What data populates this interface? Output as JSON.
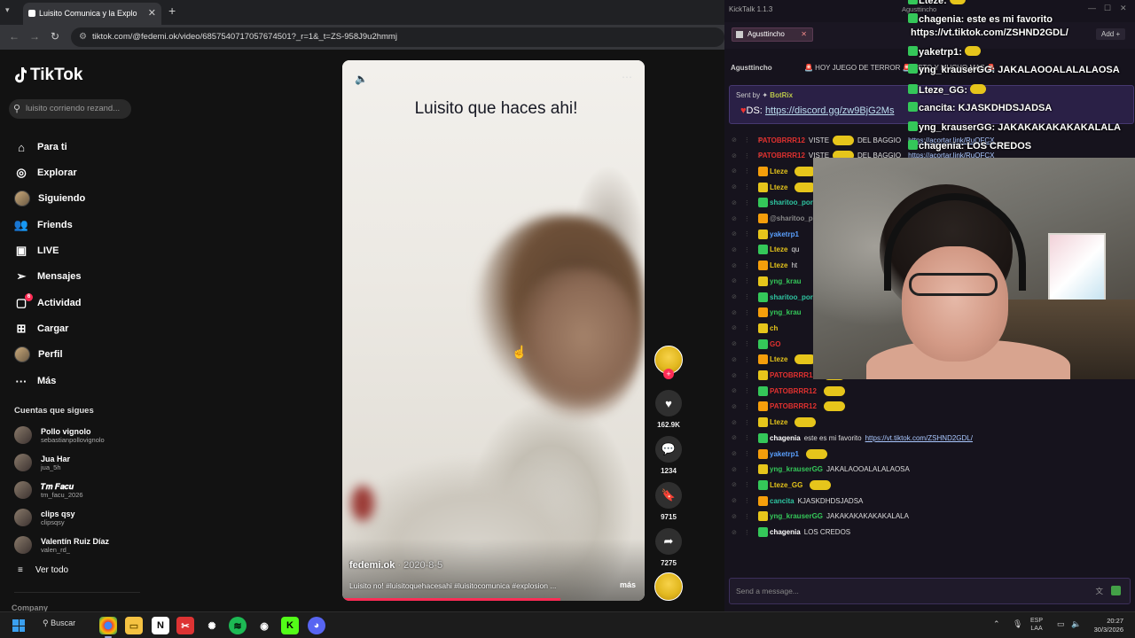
{
  "browser": {
    "tab_title": "Luisito Comunica y la Explo",
    "url": "tiktok.com/@fedemi.ok/video/6857540717057674501?_r=1&_t=ZS-958J9u2hmmj",
    "new_tab": "+",
    "tab_close": "✕"
  },
  "tiktok": {
    "logo": "TikTok",
    "search_placeholder": "luisito corriendo rezand...",
    "nav": [
      {
        "label": "Para ti",
        "icon": "home-icon"
      },
      {
        "label": "Explorar",
        "icon": "compass-icon"
      },
      {
        "label": "Siguiendo",
        "icon": "avatar"
      },
      {
        "label": "Friends",
        "icon": "friends-icon"
      },
      {
        "label": "LIVE",
        "icon": "live-icon"
      },
      {
        "label": "Mensajes",
        "icon": "send-icon"
      },
      {
        "label": "Actividad",
        "icon": "activity-icon",
        "badge": "6"
      },
      {
        "label": "Cargar",
        "icon": "upload-icon"
      },
      {
        "label": "Perfil",
        "icon": "avatar"
      },
      {
        "label": "Más",
        "icon": "more-icon"
      }
    ],
    "following_title": "Cuentas que sigues",
    "following": [
      {
        "name": "Pollo vignolo",
        "handle": "sebastianpollovignolo"
      },
      {
        "name": "Jua Har",
        "handle": "jua_5h"
      },
      {
        "name": "𝑻𝒎 𝑭𝒂𝒄𝒖",
        "handle": "tm_facu_2026"
      },
      {
        "name": "clips qsy",
        "handle": "clipsqsy"
      },
      {
        "name": "Valentín Ruiz Díaz",
        "handle": "valen_rd_"
      }
    ],
    "see_all": "Ver todo",
    "company": "Company",
    "video": {
      "caption": "Luisito que haces ahi!",
      "author": "fedemi.ok",
      "date": " · 2020-8-5",
      "description": "Luisito no! #luisitoquehacesahi #luisitocomunica #explosion ...",
      "more": "más",
      "progress": 0.72
    },
    "actions": {
      "likes": "162.9K",
      "comments": "1234",
      "saves": "9715",
      "shares": "7275"
    }
  },
  "kicktalk": {
    "title": "KickTalk 1.1.3",
    "window_user": "Agusttincho",
    "tab": "Agusttincho",
    "add": "Add",
    "channel": "Agusttincho",
    "stream_title": "🚨 HOY JUEGO DE TERROR 🚨 ESTO Y MUCHO MAS 🚨",
    "pinned_by_label": "Sent by",
    "pinned_by": "BotRix",
    "pinned_ds": "DS:",
    "pinned_link": "https://discord.gg/zw9BjG2Ms",
    "messages": [
      {
        "user": "PATOBRRR12",
        "text": "VISTE",
        "emote": true,
        "text2": "DEL BAGGIO",
        "link": "https://acortar.link/RuQFCX",
        "color": "#e0312f"
      },
      {
        "user": "PATOBRRR12",
        "text": "VISTE",
        "emote": true,
        "text2": "DEL BAGGIO",
        "link": "https://acortar.link/RuQFCX",
        "color": "#e0312f"
      },
      {
        "user": "Lteze",
        "text": "",
        "emote": true,
        "color": "#e6c51b"
      },
      {
        "user": "Lteze",
        "text": "",
        "emote": true,
        "color": "#e6c51b"
      },
      {
        "user": "sharitoo_por",
        "text": "",
        "color": "#2ec4a0"
      },
      {
        "user": "@sharitoo_por: lo",
        "text": "",
        "color": "#888"
      },
      {
        "user": "yaketrp1",
        "text": "",
        "color": "#5aa0ff"
      },
      {
        "user": "Lteze",
        "text": "qu",
        "color": "#e6c51b"
      },
      {
        "user": "Lteze",
        "text": "ht",
        "color": "#e6c51b"
      },
      {
        "user": "yng_krau",
        "text": "",
        "color": "#34c759"
      },
      {
        "user": "sharitoo_por",
        "text": "",
        "color": "#2ec4a0"
      },
      {
        "user": "yng_krau",
        "text": "",
        "color": "#34c759"
      },
      {
        "user": "ch",
        "text": "",
        "color": "#e6c51b"
      },
      {
        "user": "GO",
        "text": "",
        "color": "#e0312f"
      },
      {
        "user": "Lteze",
        "text": "",
        "emote": true,
        "color": "#e6c51b"
      },
      {
        "user": "PATOBRRR12",
        "text": "",
        "emote": true,
        "color": "#e0312f"
      },
      {
        "user": "PATOBRRR12",
        "text": "",
        "emote": true,
        "color": "#e0312f"
      },
      {
        "user": "PATOBRRR12",
        "text": "",
        "emote": true,
        "color": "#e0312f"
      },
      {
        "user": "Lteze",
        "text": "",
        "emote": true,
        "color": "#e6c51b"
      },
      {
        "user": "chagenia",
        "text": "este es mi favorito",
        "link": "https://vt.tiktok.com/ZSHND2GDL/",
        "color": "#ffffff"
      },
      {
        "user": "yaketrp1",
        "text": "",
        "emote": true,
        "color": "#5aa0ff"
      },
      {
        "user": "yng_krauserGG",
        "text": "JAKALAOOALALALAOSA",
        "color": "#34c759"
      },
      {
        "user": "Lteze_GG",
        "text": "",
        "emote": true,
        "color": "#e6c51b"
      },
      {
        "user": "cancita",
        "text": "KJASKDHDSJADSA",
        "color": "#2ec4a0"
      },
      {
        "user": "yng_krauserGG",
        "text": "JAKAKAKAKAKAKALALA",
        "color": "#34c759"
      },
      {
        "user": "chagenia",
        "text": "LOS CREDOS",
        "color": "#ffffff"
      }
    ],
    "input_placeholder": "Send a message...",
    "overlay": [
      {
        "user": "Lteze:",
        "text": "",
        "emote": true
      },
      {
        "user": "chagenia:",
        "text": "este es mi favorito"
      },
      {
        "user": "",
        "text": "https://vt.tiktok.com/ZSHND2GDL/"
      },
      {
        "user": "yaketrp1:",
        "text": "",
        "emote": true
      },
      {
        "user": "yng_krauserGG:",
        "text": "JAKALAOOALALALAOSA"
      },
      {
        "user": "Lteze_GG:",
        "text": "",
        "emote": true
      },
      {
        "user": "cancita:",
        "text": "KJASKDHDSJADSA"
      },
      {
        "user": "yng_krauserGG:",
        "text": "JAKAKAKAKAKAKALALA"
      },
      {
        "user": "chagenia:",
        "text": "LOS CREDOS"
      }
    ]
  },
  "taskbar": {
    "search": "Buscar",
    "lang1": "ESP",
    "lang2": "LAA",
    "time": "20:27",
    "date": "30/3/2026"
  },
  "colors": {
    "tiktok_red": "#fe2c55",
    "kick_bg": "#16131d",
    "pinned_bg": "#2a2046"
  }
}
